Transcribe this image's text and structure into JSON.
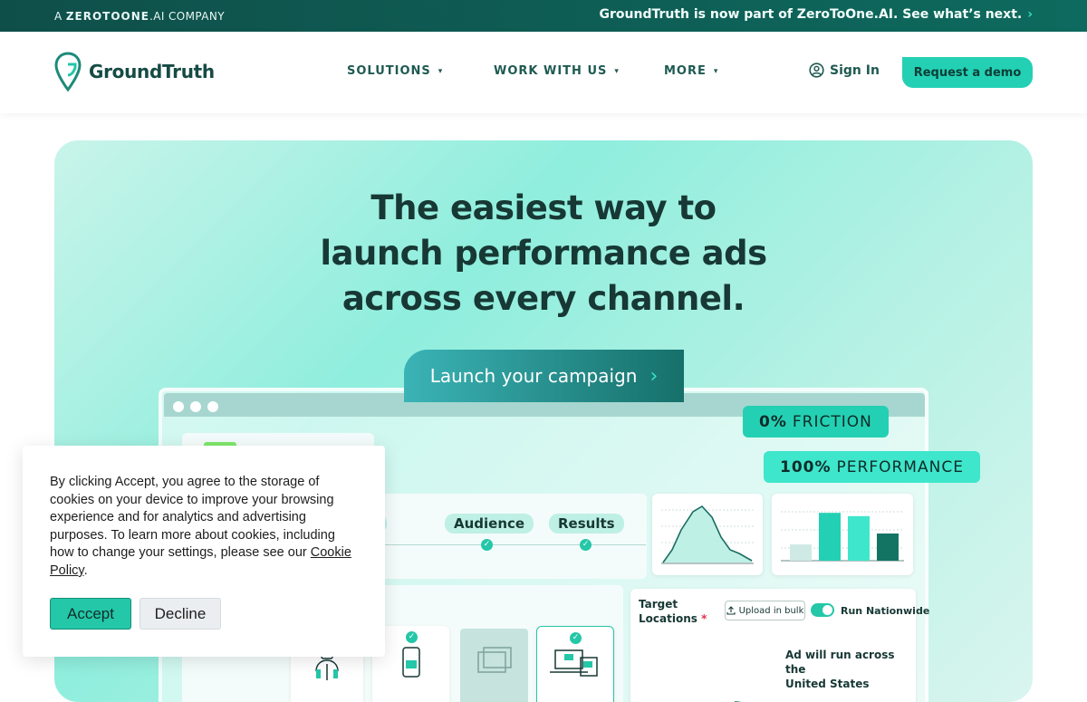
{
  "topbar": {
    "brand_prefix": "A",
    "brand_name": "ZEROTOONE",
    "brand_suffix": ".AI",
    "brand_company": "COMPANY",
    "notice": "GroundTruth is now part of ZeroToOne.AI. See what’s next.",
    "notice_chevron": "chevron-right-icon"
  },
  "header": {
    "logo_text": "GroundTruth",
    "nav": [
      {
        "label": "SOLUTIONS"
      },
      {
        "label": "WORK WITH US"
      },
      {
        "label": "MORE"
      }
    ],
    "signin_label": "Sign In",
    "demo_label": "Request a demo"
  },
  "hero": {
    "title_line1": "The easiest way to",
    "title_line2": "launch performance ads",
    "title_line3": "across every channel.",
    "cta_label": "Launch your campaign"
  },
  "mockup": {
    "friction_value": "0%",
    "friction_label": "FRICTION",
    "performance_value": "100%",
    "performance_label": "PERFORMANCE",
    "steps": [
      "ion",
      "Audience",
      "Results"
    ],
    "target_label_line1": "Target",
    "target_label_line2": "Locations",
    "target_required": "*",
    "upload_label": "Upload in bulk",
    "run_nationwide_label": "Run Nationwide",
    "nationwide_note_line1": "Ad will run across the",
    "nationwide_note_line2": "United States",
    "bar_chart_values": [
      0.3,
      0.88,
      0.82,
      0.5
    ]
  },
  "cookie": {
    "text": "By clicking Accept, you agree to the storage of cookies on your device to improve your browsing experience and for analytics and advertising purposes. To learn more about cookies, including how to change your settings, please see our",
    "link_text": "Cookie Policy",
    "after_link": ".",
    "accept_label": "Accept",
    "decline_label": "Decline"
  },
  "colors": {
    "accent": "#24d0b3",
    "dark_teal": "#0f4f4a",
    "heading": "#173834"
  }
}
